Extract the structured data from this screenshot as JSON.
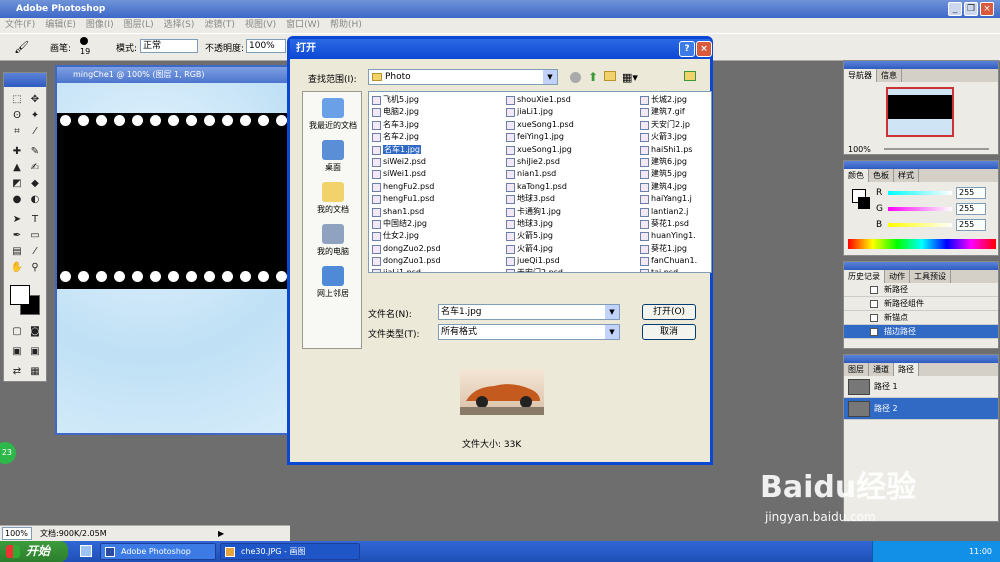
{
  "app": {
    "title": "Adobe Photoshop"
  },
  "menu": [
    "文件(F)",
    "编辑(E)",
    "图像(I)",
    "图层(L)",
    "选择(S)",
    "滤镜(T)",
    "视图(V)",
    "窗口(W)",
    "帮助(H)"
  ],
  "options": {
    "brush_label": "画笔:",
    "brush_size": "19",
    "mode_label": "模式:",
    "mode_value": "正常",
    "opacity_label": "不透明度:",
    "opacity_value": "100%"
  },
  "document": {
    "title": "mingChe1 @ 100% (图层 1, RGB)"
  },
  "dialog": {
    "title": "打开",
    "lookin_label": "查找范围(I):",
    "lookin_value": "Photo",
    "places": [
      "我最近的文档",
      "桌面",
      "我的文档",
      "我的电脑",
      "网上邻居"
    ],
    "files_col1": [
      "飞机5.jpg",
      "电脑2.jpg",
      "名车3.jpg",
      "名车2.jpg",
      "名车1.jpg",
      "siWei2.psd",
      "siWei1.psd",
      "hengFu2.psd",
      "hengFu1.psd",
      "shan1.psd",
      "中国结2.jpg",
      "仕女2.jpg",
      "dongZuo2.psd",
      "dongZuo1.psd",
      "jiaLi1.psd"
    ],
    "files_col2": [
      "shouXie1.psd",
      "jiaLi1.jpg",
      "xueSong1.psd",
      "feiYing1.jpg",
      "xueSong1.jpg",
      "shiJie2.psd",
      "nian1.psd",
      "kaTong1.psd",
      "地球3.psd",
      "卡通狗1.jpg",
      "地球3.jpg",
      "火箭5.jpg",
      "火箭4.jpg",
      "jueQi1.psd",
      "天安门2.psd"
    ],
    "files_col3": [
      "长城2.jpg",
      "建筑7.gif",
      "天安门2.jp",
      "火箭3.jpg",
      "haiShi1.ps",
      "建筑6.jpg",
      "建筑5.jpg",
      "建筑4.jpg",
      "haiYang1.j",
      "lantian2.j",
      "葵花1.psd",
      "huanYing1.",
      "葵花1.jpg",
      "fanChuan1.",
      "tai.psd"
    ],
    "selected_file": "名车1.jpg",
    "filename_label": "文件名(N):",
    "filename_value": "名车1.jpg",
    "filetype_label": "文件类型(T):",
    "filetype_value": "所有格式",
    "open_button": "打开(O)",
    "cancel_button": "取消",
    "filesize": "文件大小: 33K"
  },
  "navigator": {
    "tabs": [
      "导航器",
      "信息"
    ],
    "zoom": "100%"
  },
  "color": {
    "tabs": [
      "颜色",
      "色板",
      "样式"
    ],
    "r_label": "R",
    "r": "255",
    "g_label": "G",
    "g": "255",
    "b_label": "B",
    "b": "255"
  },
  "history": {
    "tabs": [
      "历史记录",
      "动作",
      "工具预设"
    ],
    "items": [
      "新路径",
      "新路径组件",
      "新锚点",
      "描边路径"
    ]
  },
  "layers": {
    "tabs": [
      "图层",
      "通道",
      "路径"
    ],
    "paths": [
      "路径 1",
      "路径 2"
    ]
  },
  "status": {
    "zoom": "100%",
    "doc": "文档:900K/2.05M"
  },
  "taskbar": {
    "start": "开始",
    "task1": "Adobe Photoshop",
    "task2": "che30.JPG - 画图",
    "clock": "11:00"
  },
  "side_badge": "23",
  "watermark": {
    "main": "Baidu经验",
    "sub": "jingyan.baidu.com"
  },
  "colors": {
    "xp_blue": "#0a47d2",
    "selection": "#316ac5",
    "panel_bg": "#ecebe5"
  }
}
